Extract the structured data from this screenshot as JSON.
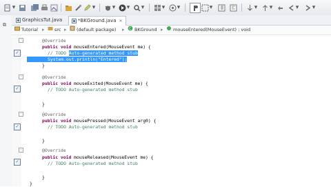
{
  "tabs": [
    {
      "label": "GraphicsTut.java",
      "active": false
    },
    {
      "label": "*BKGround.java",
      "active": true
    }
  ],
  "breadcrumb": [
    "Tutorial",
    "src",
    "(default package)",
    "BKGround",
    "mouseEntered(MouseEvent) : void"
  ],
  "code": {
    "entered_annotation": "@Override",
    "entered_sig_kw": "public void",
    "entered_sig": " mouseEntered(MouseEvent me) {",
    "entered_todo": "// TODO",
    "entered_todo_sel": "Auto-generated method stub",
    "entered_println": "System.out.println(\"Entered\");",
    "close1": "}",
    "exited_annotation": "@Override",
    "exited_sig_kw": "public void",
    "exited_sig": " mouseExited(MouseEvent me) {",
    "exited_todo": "// TODO Auto-generated method stub",
    "close2": "}",
    "pressed_annotation": "@Override",
    "pressed_sig_kw": "public void",
    "pressed_sig": " mousePressed(MouseEvent arg0) {",
    "pressed_todo": "// TODO Auto-generated method stub",
    "close3": "}",
    "released_annotation": "@Override",
    "released_sig_kw": "public void",
    "released_sig": " mouseReleased(MouseEvent me) {",
    "released_todo": "// TODO Auto-generated method stub",
    "close4": "}",
    "close5": "}"
  },
  "icons": [
    "new-icon",
    "save-icon",
    "print-icon",
    "debug-icon",
    "run-icon",
    "search-icon",
    "back-icon",
    "forward-icon"
  ]
}
